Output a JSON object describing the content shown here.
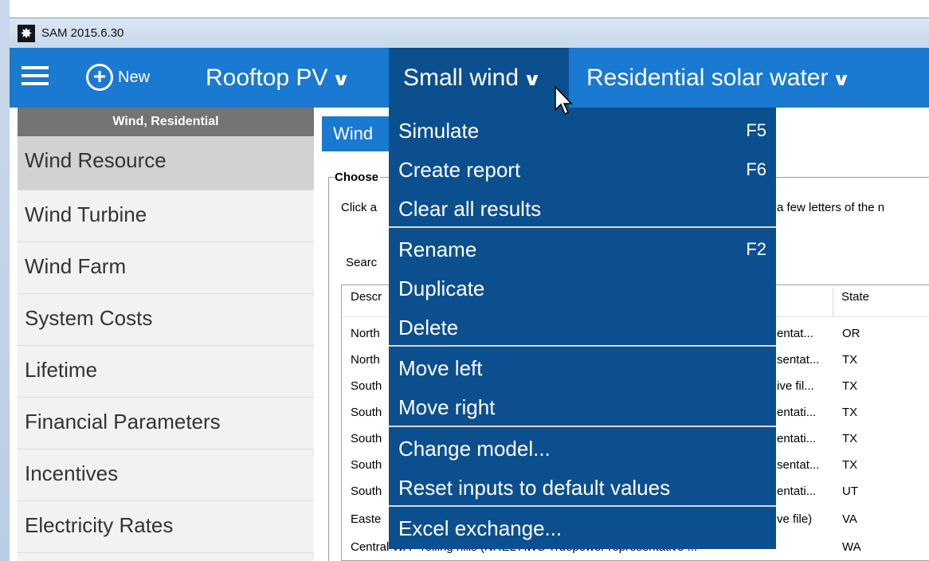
{
  "window": {
    "title": "SAM 2015.6.30",
    "icon": "sun-icon"
  },
  "menubar": {
    "new_label": "New",
    "tabs": [
      {
        "label": "Rooftop PV",
        "active": false
      },
      {
        "label": "Small wind",
        "active": true
      },
      {
        "label": "Residential solar water",
        "active": false
      }
    ]
  },
  "sidebar": {
    "header": "Wind, Residential",
    "items": [
      {
        "label": "Wind Resource",
        "selected": true
      },
      {
        "label": "Wind Turbine"
      },
      {
        "label": "Wind Farm"
      },
      {
        "label": "System Costs"
      },
      {
        "label": "Lifetime"
      },
      {
        "label": "Financial Parameters"
      },
      {
        "label": "Incentives"
      },
      {
        "label": "Electricity Rates"
      }
    ]
  },
  "main": {
    "tab_label": "Wind",
    "group_title": "Choose",
    "hint_left": "Click a",
    "hint_right": "a few letters of the n",
    "search_label": "Searc",
    "table": {
      "col_description": "Descr",
      "col_state": "State",
      "rows": [
        {
          "c1": "North",
          "c2": "entat...",
          "state": "OR"
        },
        {
          "c1": "North",
          "c2": "sentat...",
          "state": "TX"
        },
        {
          "c1": "South",
          "c2": "ive fil...",
          "state": "TX"
        },
        {
          "c1": "South",
          "c2": "entati...",
          "state": "TX"
        },
        {
          "c1": "South",
          "c2": "entati...",
          "state": "TX"
        },
        {
          "c1": "South",
          "c2": "sentat...",
          "state": "TX"
        },
        {
          "c1": "South",
          "c2": "entati...",
          "state": "UT"
        },
        {
          "c1": "Easte",
          "c2": "ve file)",
          "state": "VA"
        },
        {
          "c1": "Central WA - rolling hills (NREL AWS Truepower representative ...",
          "c2": "",
          "state": "WA"
        }
      ]
    }
  },
  "dropdown": {
    "items": [
      {
        "label": "Simulate",
        "shortcut": "F5"
      },
      {
        "label": "Create report",
        "shortcut": "F6"
      },
      {
        "label": "Clear all results",
        "shortcut": ""
      },
      {
        "label": "Rename",
        "shortcut": "F2"
      },
      {
        "label": "Duplicate",
        "shortcut": ""
      },
      {
        "label": "Delete",
        "shortcut": ""
      },
      {
        "label": "Move left",
        "shortcut": ""
      },
      {
        "label": "Move right",
        "shortcut": ""
      },
      {
        "label": "Change model...",
        "shortcut": ""
      },
      {
        "label": "Reset inputs to default values",
        "shortcut": ""
      },
      {
        "label": "Excel exchange...",
        "shortcut": ""
      }
    ]
  },
  "colors": {
    "menubar": "#1a79d0",
    "menu_active": "#0c4f8e",
    "sidebar_header": "#747474",
    "sidebar_selected": "#d2d2d2"
  }
}
